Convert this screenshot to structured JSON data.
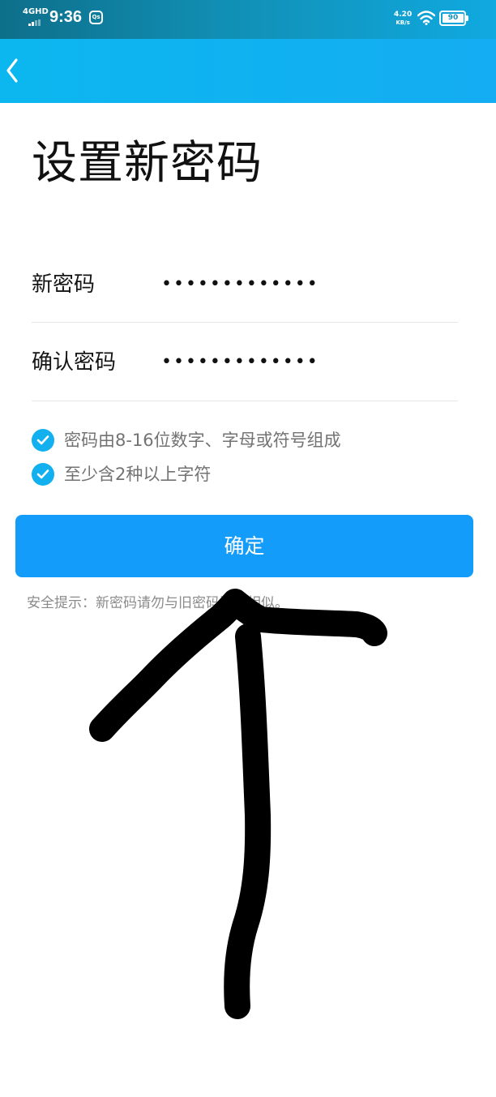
{
  "status_bar": {
    "network": "4GHD",
    "time": "9:36",
    "app_badge": "Qs",
    "speed_value": "4.20",
    "speed_unit": "KB/s",
    "battery": "90"
  },
  "header": {
    "back_icon": "chevron-left-icon"
  },
  "page": {
    "title": "设置新密码"
  },
  "form": {
    "new_password": {
      "label": "新密码",
      "value": "•••••••••••••"
    },
    "confirm_password": {
      "label": "确认密码",
      "value": "•••••••••••••"
    }
  },
  "rules": [
    {
      "icon": "check-circle-icon",
      "text": "密码由8-16位数字、字母或符号组成"
    },
    {
      "icon": "check-circle-icon",
      "text": "至少含2种以上字符"
    }
  ],
  "confirm_button": {
    "label": "确定"
  },
  "security_tip": "安全提示：新密码请勿与旧密码过于相似。",
  "colors": {
    "header": "#14acf2",
    "button": "#139cf9",
    "check": "#12b0ef",
    "annotation": "#000000"
  }
}
